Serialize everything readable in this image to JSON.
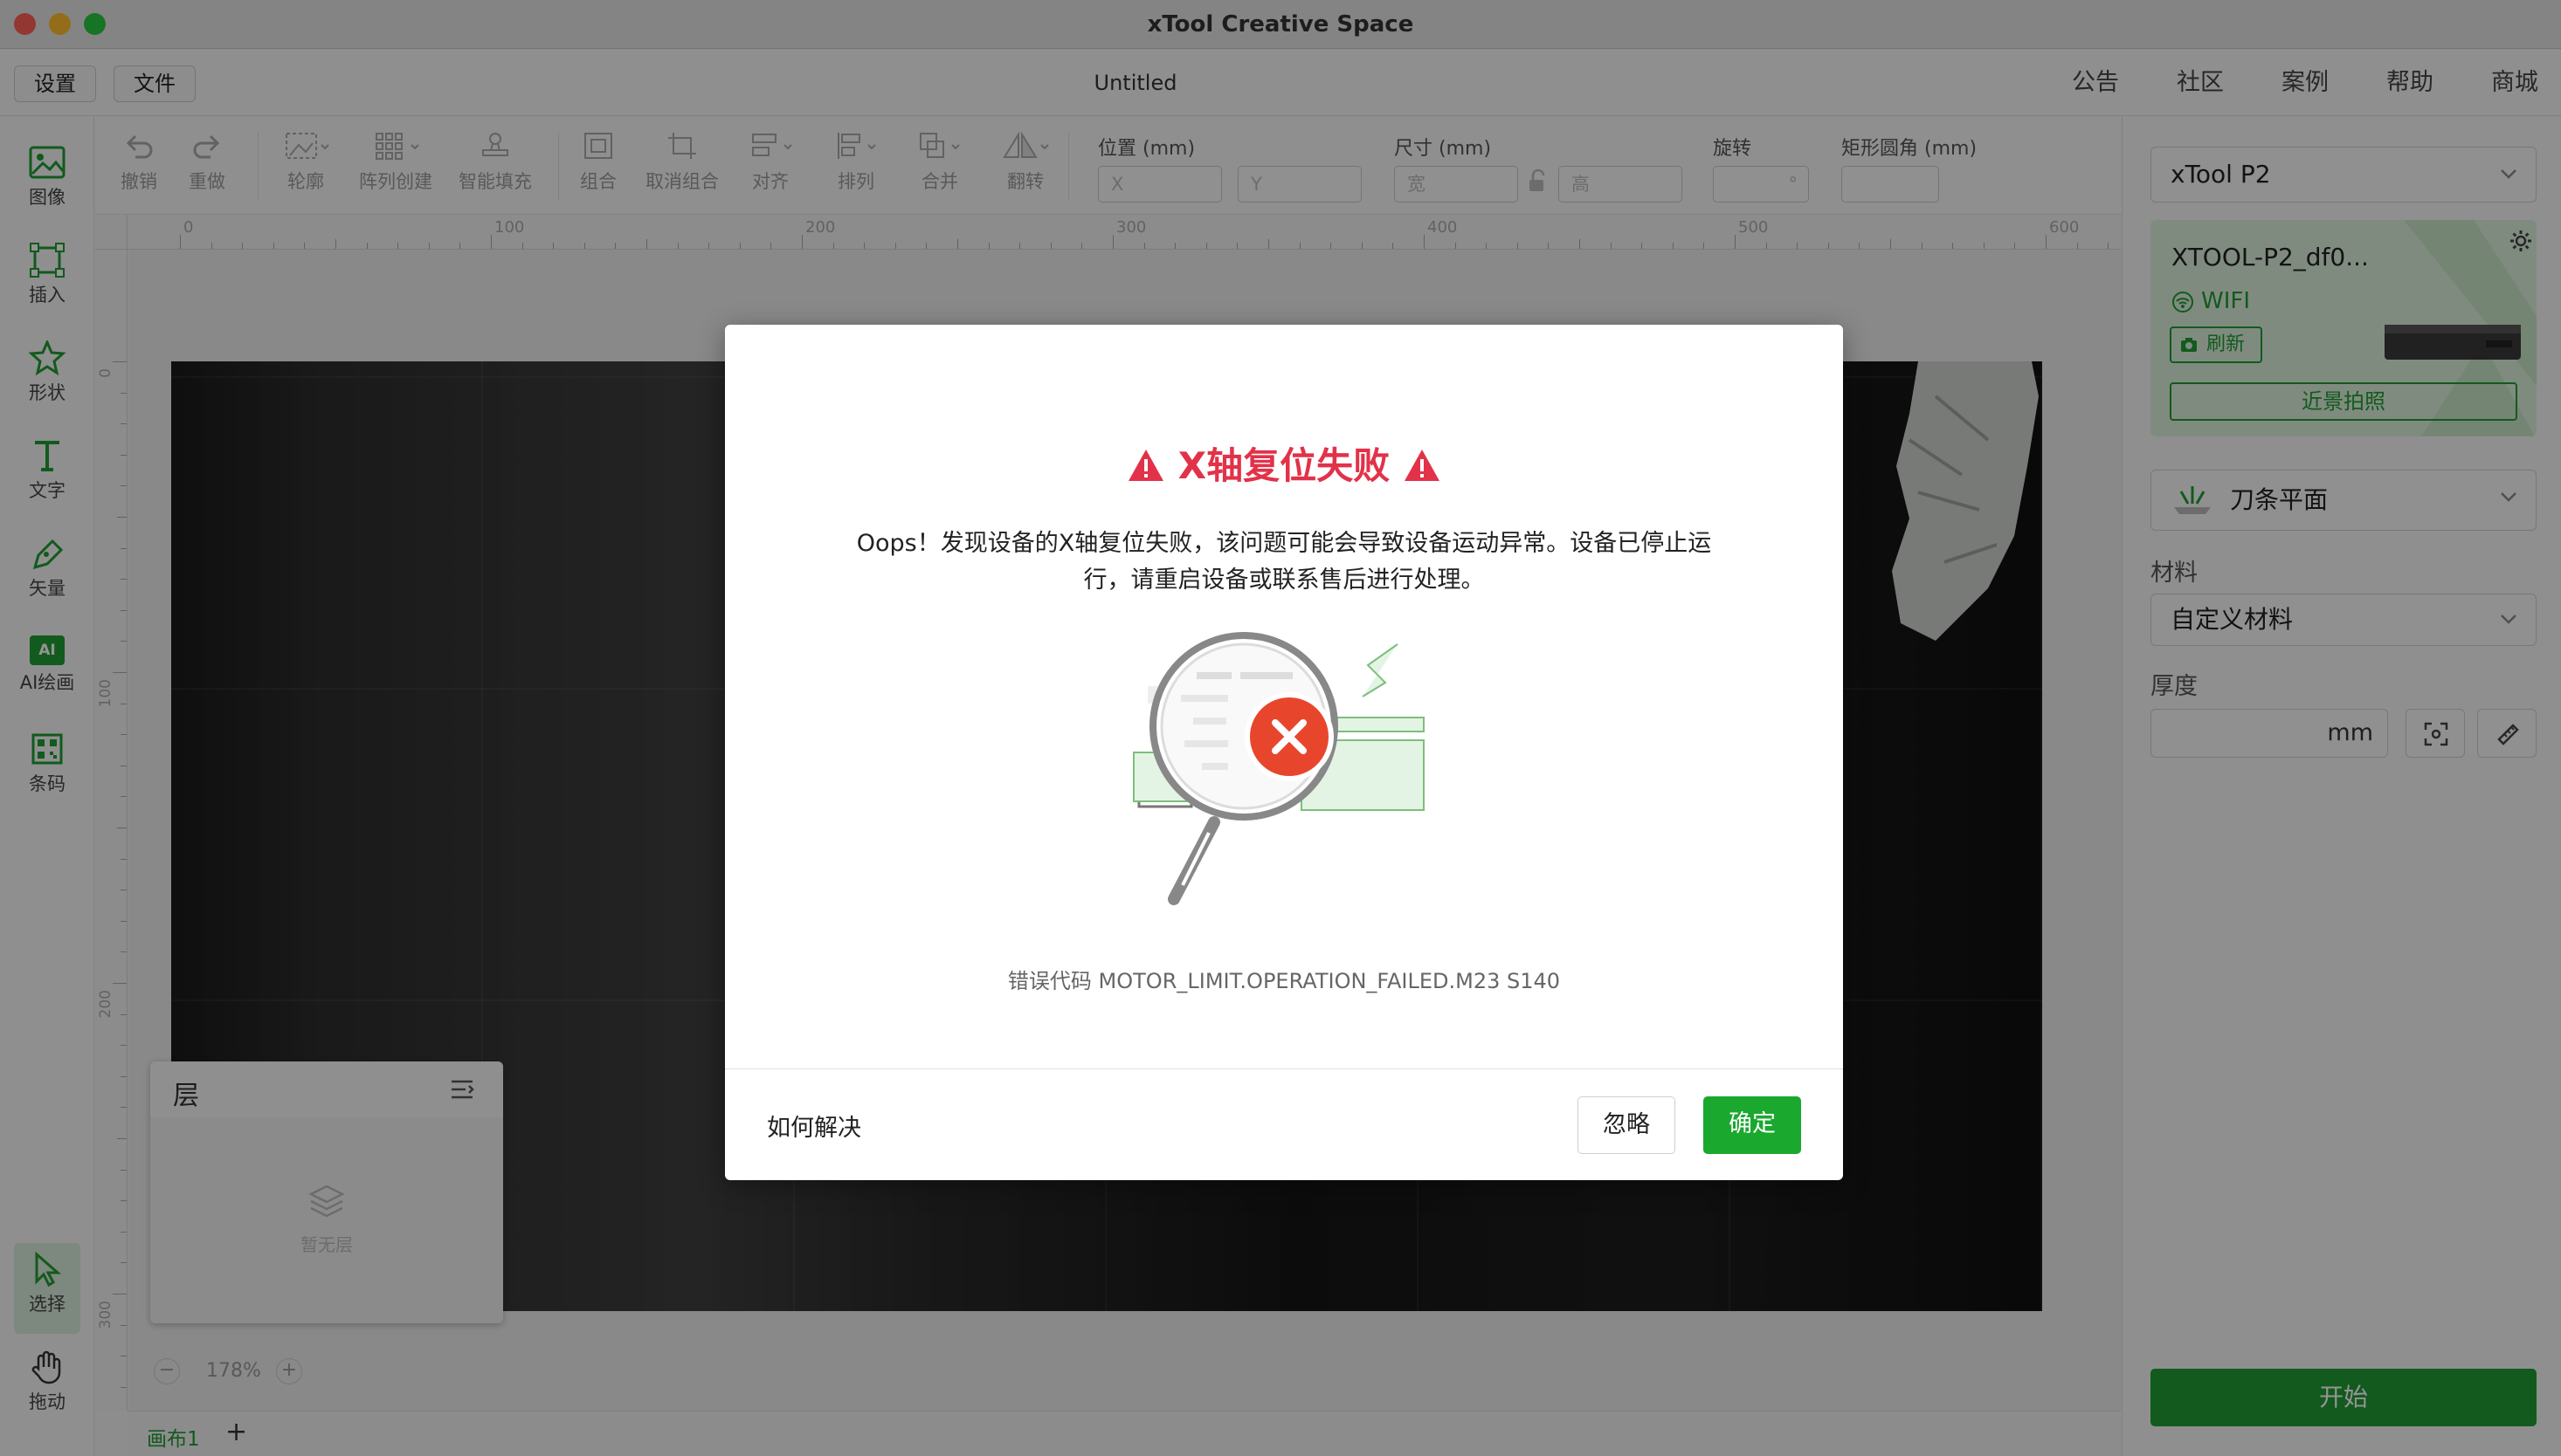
{
  "window": {
    "title": "xTool Creative Space"
  },
  "menu": {
    "settings": "设置",
    "file": "文件",
    "document_title": "Untitled",
    "links": [
      "公告",
      "社区",
      "案例",
      "帮助",
      "商城"
    ]
  },
  "left_tools": [
    "图像",
    "插入",
    "形状",
    "文字",
    "矢量",
    "AI绘画",
    "条码"
  ],
  "left_tools_bottom": [
    "选择",
    "拖动"
  ],
  "ai_badge": "AI",
  "toolbar": {
    "undo": "撤销",
    "redo": "重做",
    "outline": "轮廓",
    "array": "阵列创建",
    "smart_fill": "智能填充",
    "group": "组合",
    "ungroup": "取消组合",
    "align": "对齐",
    "arrange": "排列",
    "combine": "合并",
    "flip": "翻转",
    "position_label": "位置 (mm)",
    "x_placeholder": "X",
    "y_placeholder": "Y",
    "size_label": "尺寸 (mm)",
    "width_placeholder": "宽",
    "height_placeholder": "高",
    "rotate_label": "旋转",
    "rotate_unit": "°",
    "corner_label": "矩形圆角 (mm)"
  },
  "ruler": {
    "h_ticks": [
      "0",
      "100",
      "200",
      "300",
      "400",
      "500",
      "600"
    ],
    "v_ticks": [
      "0",
      "100",
      "200",
      "300"
    ]
  },
  "layer_panel": {
    "title": "层",
    "empty_text": "暂无层"
  },
  "zoom": {
    "minus": "−",
    "value": "178%",
    "plus": "+"
  },
  "tabs": {
    "canvas1": "画布1",
    "add": "+"
  },
  "right_panel": {
    "device_select": "xTool P2",
    "device_name": "XTOOL-P2_df0...",
    "connection": "WIFI",
    "refresh": "刷新",
    "closeup": "近景拍照",
    "platform": "刀条平面",
    "material_label": "材料",
    "material_value": "自定义材料",
    "thickness_label": "厚度",
    "thickness_unit": "mm",
    "start": "开始"
  },
  "modal": {
    "title": "X轴复位失败",
    "message": "Oops！发现设备的X轴复位失败，该问题可能会导致设备运动异常。设备已停止运行，请重启设备或联系售后进行处理。",
    "error_code": "错误代码 MOTOR_LIMIT.OPERATION_FAILED.M23 S140",
    "how_to_fix": "如何解决",
    "ignore": "忽略",
    "confirm": "确定"
  },
  "colors": {
    "accent_green": "#1f9b32",
    "error_red": "#e23249",
    "light_green": "#dcefdc"
  }
}
